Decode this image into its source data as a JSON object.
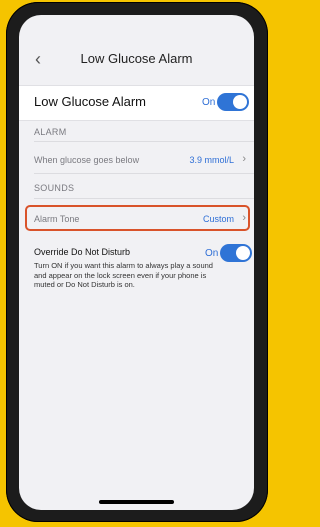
{
  "nav": {
    "back_icon": "chevron-left-icon",
    "title": "Low Glucose Alarm"
  },
  "main_toggle": {
    "label": "Low Glucose Alarm",
    "state_label": "On",
    "enabled": true
  },
  "sections": {
    "alarm_header": "ALARM",
    "sounds_header": "SOUNDS"
  },
  "glucose_threshold": {
    "label": "When glucose goes below",
    "value": "3.9 mmol/L"
  },
  "alarm_tone": {
    "label": "Alarm Tone",
    "value": "Custom"
  },
  "override": {
    "label": "Override Do Not Disturb",
    "state_label": "On",
    "enabled": true,
    "description": "Turn ON if you want this alarm to always play a sound and appear on the lock screen even if your phone is muted or Do Not Disturb is on."
  },
  "colors": {
    "accent": "#2f74d6",
    "highlight": "#d9532a",
    "background": "#f5c400"
  }
}
